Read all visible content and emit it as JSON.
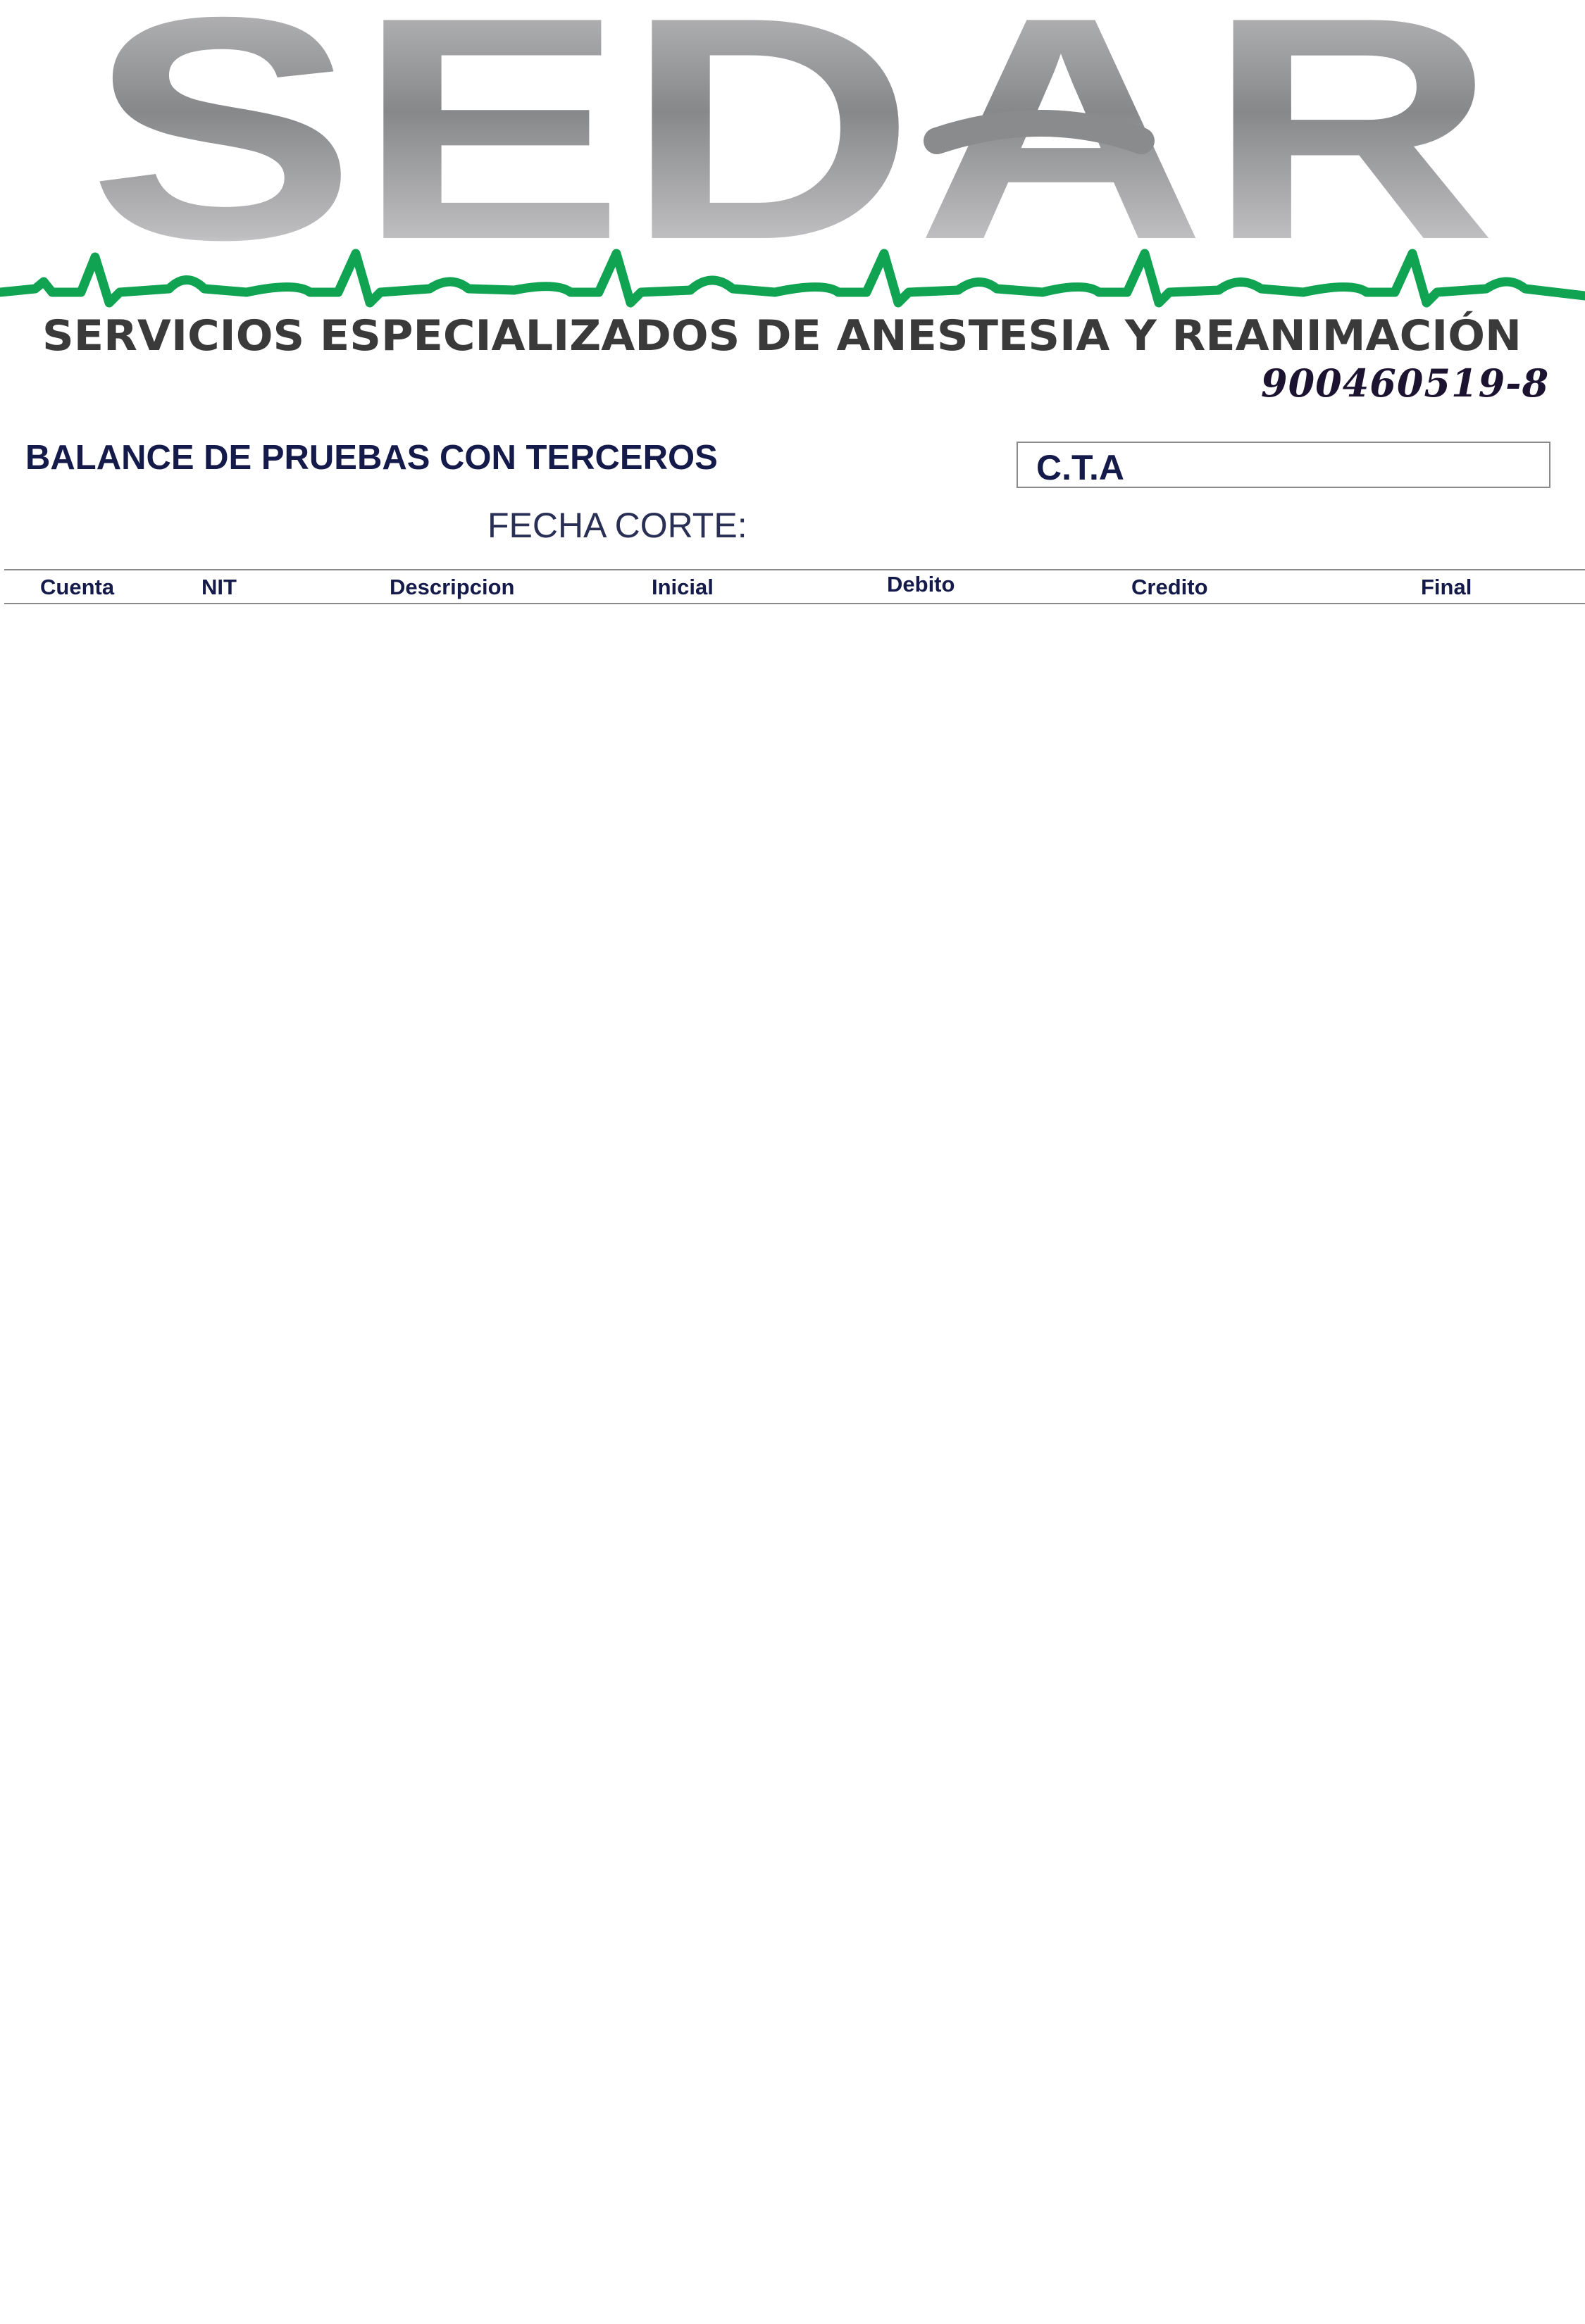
{
  "header": {
    "logo_text": "SEDAR",
    "logo_subtitle": "SERVICIOS ESPECIALIZADOS DE ANESTESIA Y REANIMACIÓN",
    "nit": "900460519-8",
    "brand_colors": {
      "logo_gray": "#8a8b8d",
      "pulse_green": "#0fa352",
      "subtitle_dark": "#3a3a3a"
    }
  },
  "report": {
    "title": "BALANCE DE PRUEBAS CON TERCEROS",
    "cta_label": "C.T.A",
    "fecha_label": "FECHA CORTE:"
  },
  "table": {
    "columns": [
      "Cuenta",
      "NIT",
      "Descripcion",
      "Inicial",
      "Debito",
      "Credito",
      "Final"
    ],
    "rows": []
  }
}
